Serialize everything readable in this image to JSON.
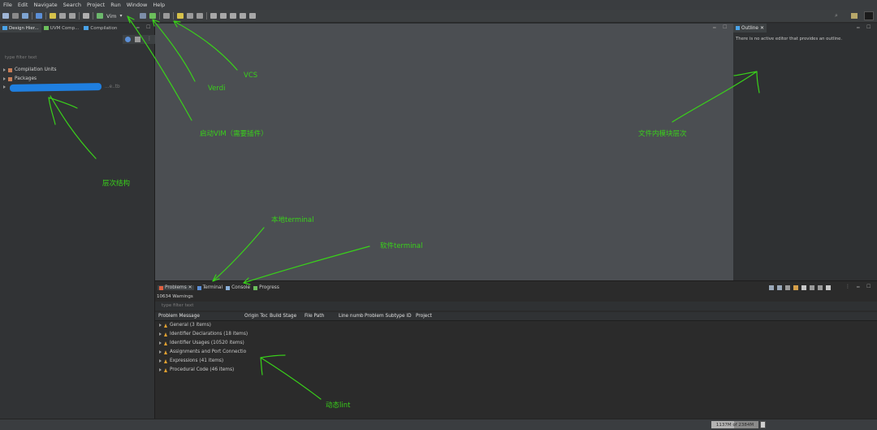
{
  "menubar": {
    "items": [
      "File",
      "Edit",
      "Navigate",
      "Search",
      "Project",
      "Run",
      "Window",
      "Help"
    ]
  },
  "toolbar": {
    "vim_label": "Vim"
  },
  "left_panel": {
    "tabs": [
      {
        "label": "Design Hier...",
        "icon": "hierarchy-icon"
      },
      {
        "label": "UVM Comp...",
        "icon": "uvm-icon"
      },
      {
        "label": "Compilation",
        "icon": "compilation-icon"
      }
    ],
    "filter_placeholder": "type filter text",
    "tree": [
      {
        "label": "Compilation Units",
        "icon": "package-icon"
      },
      {
        "label": "Packages",
        "icon": "package-icon"
      },
      {
        "label": "...e..tb",
        "icon": "module-icon"
      }
    ]
  },
  "outline": {
    "tab_label": "Outline",
    "message": "There is no active editor that provides an outline."
  },
  "bottom_panel": {
    "tabs": [
      {
        "label": "Problems",
        "icon": "problems-icon"
      },
      {
        "label": "Terminal",
        "icon": "terminal-icon"
      },
      {
        "label": "Console",
        "icon": "console-icon"
      },
      {
        "label": "Progress",
        "icon": "progress-icon"
      }
    ],
    "summary": "10634 Warnings",
    "filter_placeholder": "type filter text",
    "columns": [
      "Problem Message",
      "Origin Toc",
      "Build Stage",
      "File Path",
      "Line numb",
      "Problem Subtype ID",
      "Project"
    ],
    "rows": [
      "General (3 items)",
      "Identifier Declarations (18 items)",
      "Identifier Usages (10520 items)",
      "Assignments and Port Connectio",
      "Expressions (41 items)",
      "Procedural Code (46 items)"
    ]
  },
  "statusbar": {
    "heap": "1137M of 2384M",
    "heap_fraction": 0.48
  },
  "annotations": {
    "vcs": "VCS",
    "verdi": "Verdi",
    "vim": "启动VIM（需要插件）",
    "hierarchy": "层次结构",
    "outline": "文件内模块层次",
    "local_terminal": "本地terminal",
    "software_terminal": "软件terminal",
    "lint": "动态lint"
  },
  "colors": {
    "annotation": "#39d11a",
    "editor_bg": "#4b4e52",
    "redaction": "#1f7fe0"
  }
}
